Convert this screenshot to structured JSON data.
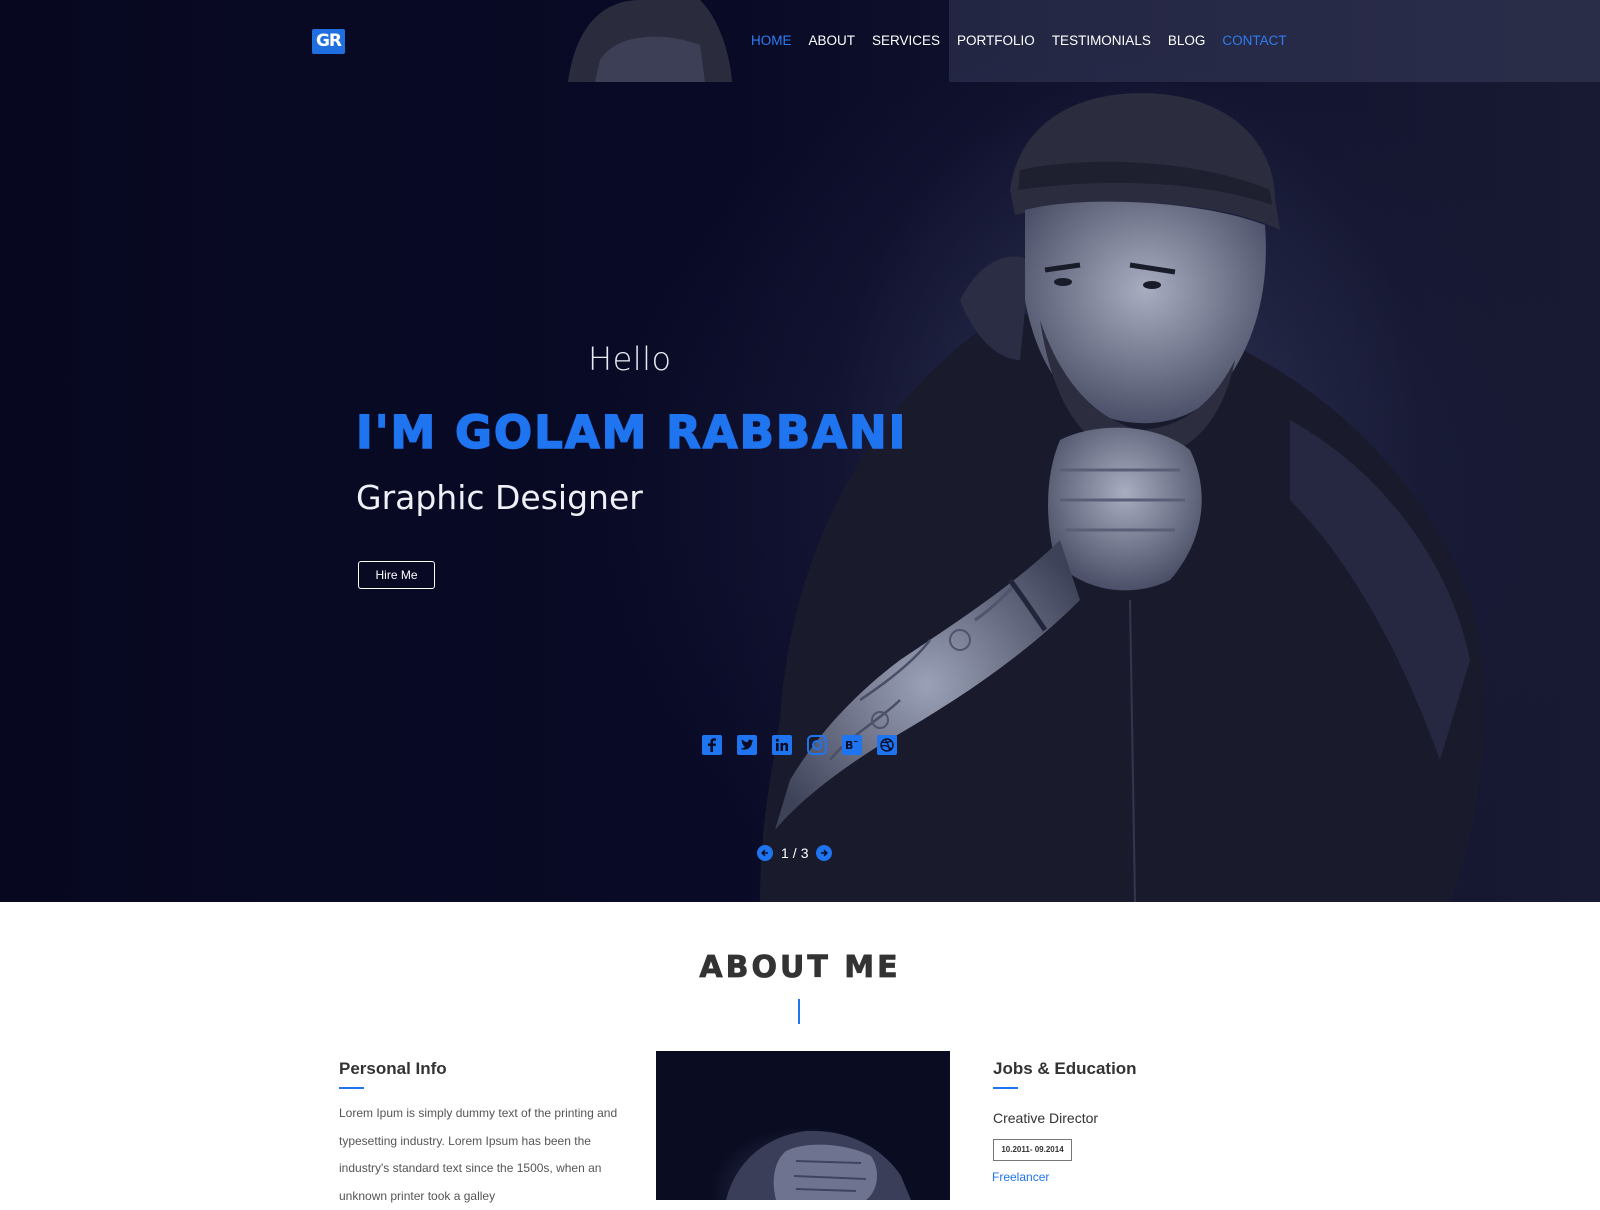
{
  "colors": {
    "accent": "#1f74f0",
    "hero_bg": "#090a26",
    "nav_text": "#ffffff"
  },
  "logo": {
    "text": "GR"
  },
  "nav": {
    "items": [
      {
        "label": "HOME",
        "state": "active"
      },
      {
        "label": "ABOUT",
        "state": "normal"
      },
      {
        "label": "SERVICES",
        "state": "normal"
      },
      {
        "label": "PORTFOLIO",
        "state": "normal"
      },
      {
        "label": "TESTIMONIALS",
        "state": "normal"
      },
      {
        "label": "BLOG",
        "state": "normal"
      },
      {
        "label": "CONTACT",
        "state": "accent"
      }
    ]
  },
  "hero": {
    "greeting": "Hello",
    "name": "I'M GOLAM RABBANI",
    "role": "Graphic Designer",
    "cta": "Hire Me",
    "socials": [
      "facebook-icon",
      "twitter-icon",
      "linkedin-icon",
      "instagram-icon",
      "behance-icon",
      "dribbble-icon"
    ],
    "slider": {
      "current": "1",
      "separator": "/",
      "total": "3"
    }
  },
  "about": {
    "title": "ABOUT ME",
    "personal_info": {
      "heading": "Personal Info",
      "text": "Lorem Ipum is simply dummy text of the printing and typesetting industry. Lorem Ipsum has been the industry's standard text since the 1500s, when an unknown printer took a galley"
    },
    "jobs": {
      "heading": "Jobs & Education",
      "title": "Creative Director",
      "date": "10.2011- 09.2014",
      "subtitle": "Freelancer"
    }
  }
}
